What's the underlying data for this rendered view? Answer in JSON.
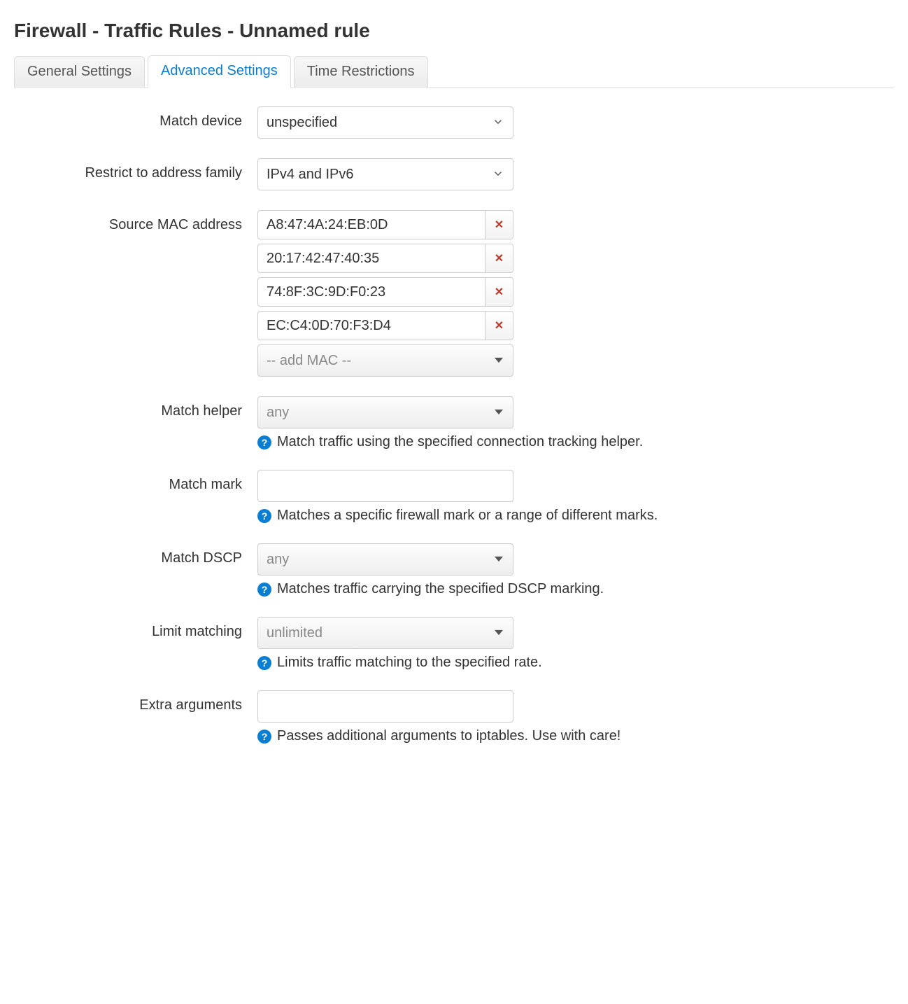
{
  "page_title": "Firewall - Traffic Rules - Unnamed rule",
  "tabs": {
    "general": "General Settings",
    "advanced": "Advanced Settings",
    "time": "Time Restrictions"
  },
  "fields": {
    "match_device": {
      "label": "Match device",
      "value": "unspecified"
    },
    "address_family": {
      "label": "Restrict to address family",
      "value": "IPv4 and IPv6"
    },
    "source_mac": {
      "label": "Source MAC address",
      "items": [
        "A8:47:4A:24:EB:0D",
        "20:17:42:47:40:35",
        "74:8F:3C:9D:F0:23",
        "EC:C4:0D:70:F3:D4"
      ],
      "add_placeholder": "-- add MAC --"
    },
    "match_helper": {
      "label": "Match helper",
      "value": "any",
      "hint": "Match traffic using the specified connection tracking helper."
    },
    "match_mark": {
      "label": "Match mark",
      "value": "",
      "hint": "Matches a specific firewall mark or a range of different marks."
    },
    "match_dscp": {
      "label": "Match DSCP",
      "value": "any",
      "hint": "Matches traffic carrying the specified DSCP marking."
    },
    "limit_matching": {
      "label": "Limit matching",
      "value": "unlimited",
      "hint": "Limits traffic matching to the specified rate."
    },
    "extra_arguments": {
      "label": "Extra arguments",
      "value": "",
      "hint": "Passes additional arguments to iptables. Use with care!"
    }
  }
}
